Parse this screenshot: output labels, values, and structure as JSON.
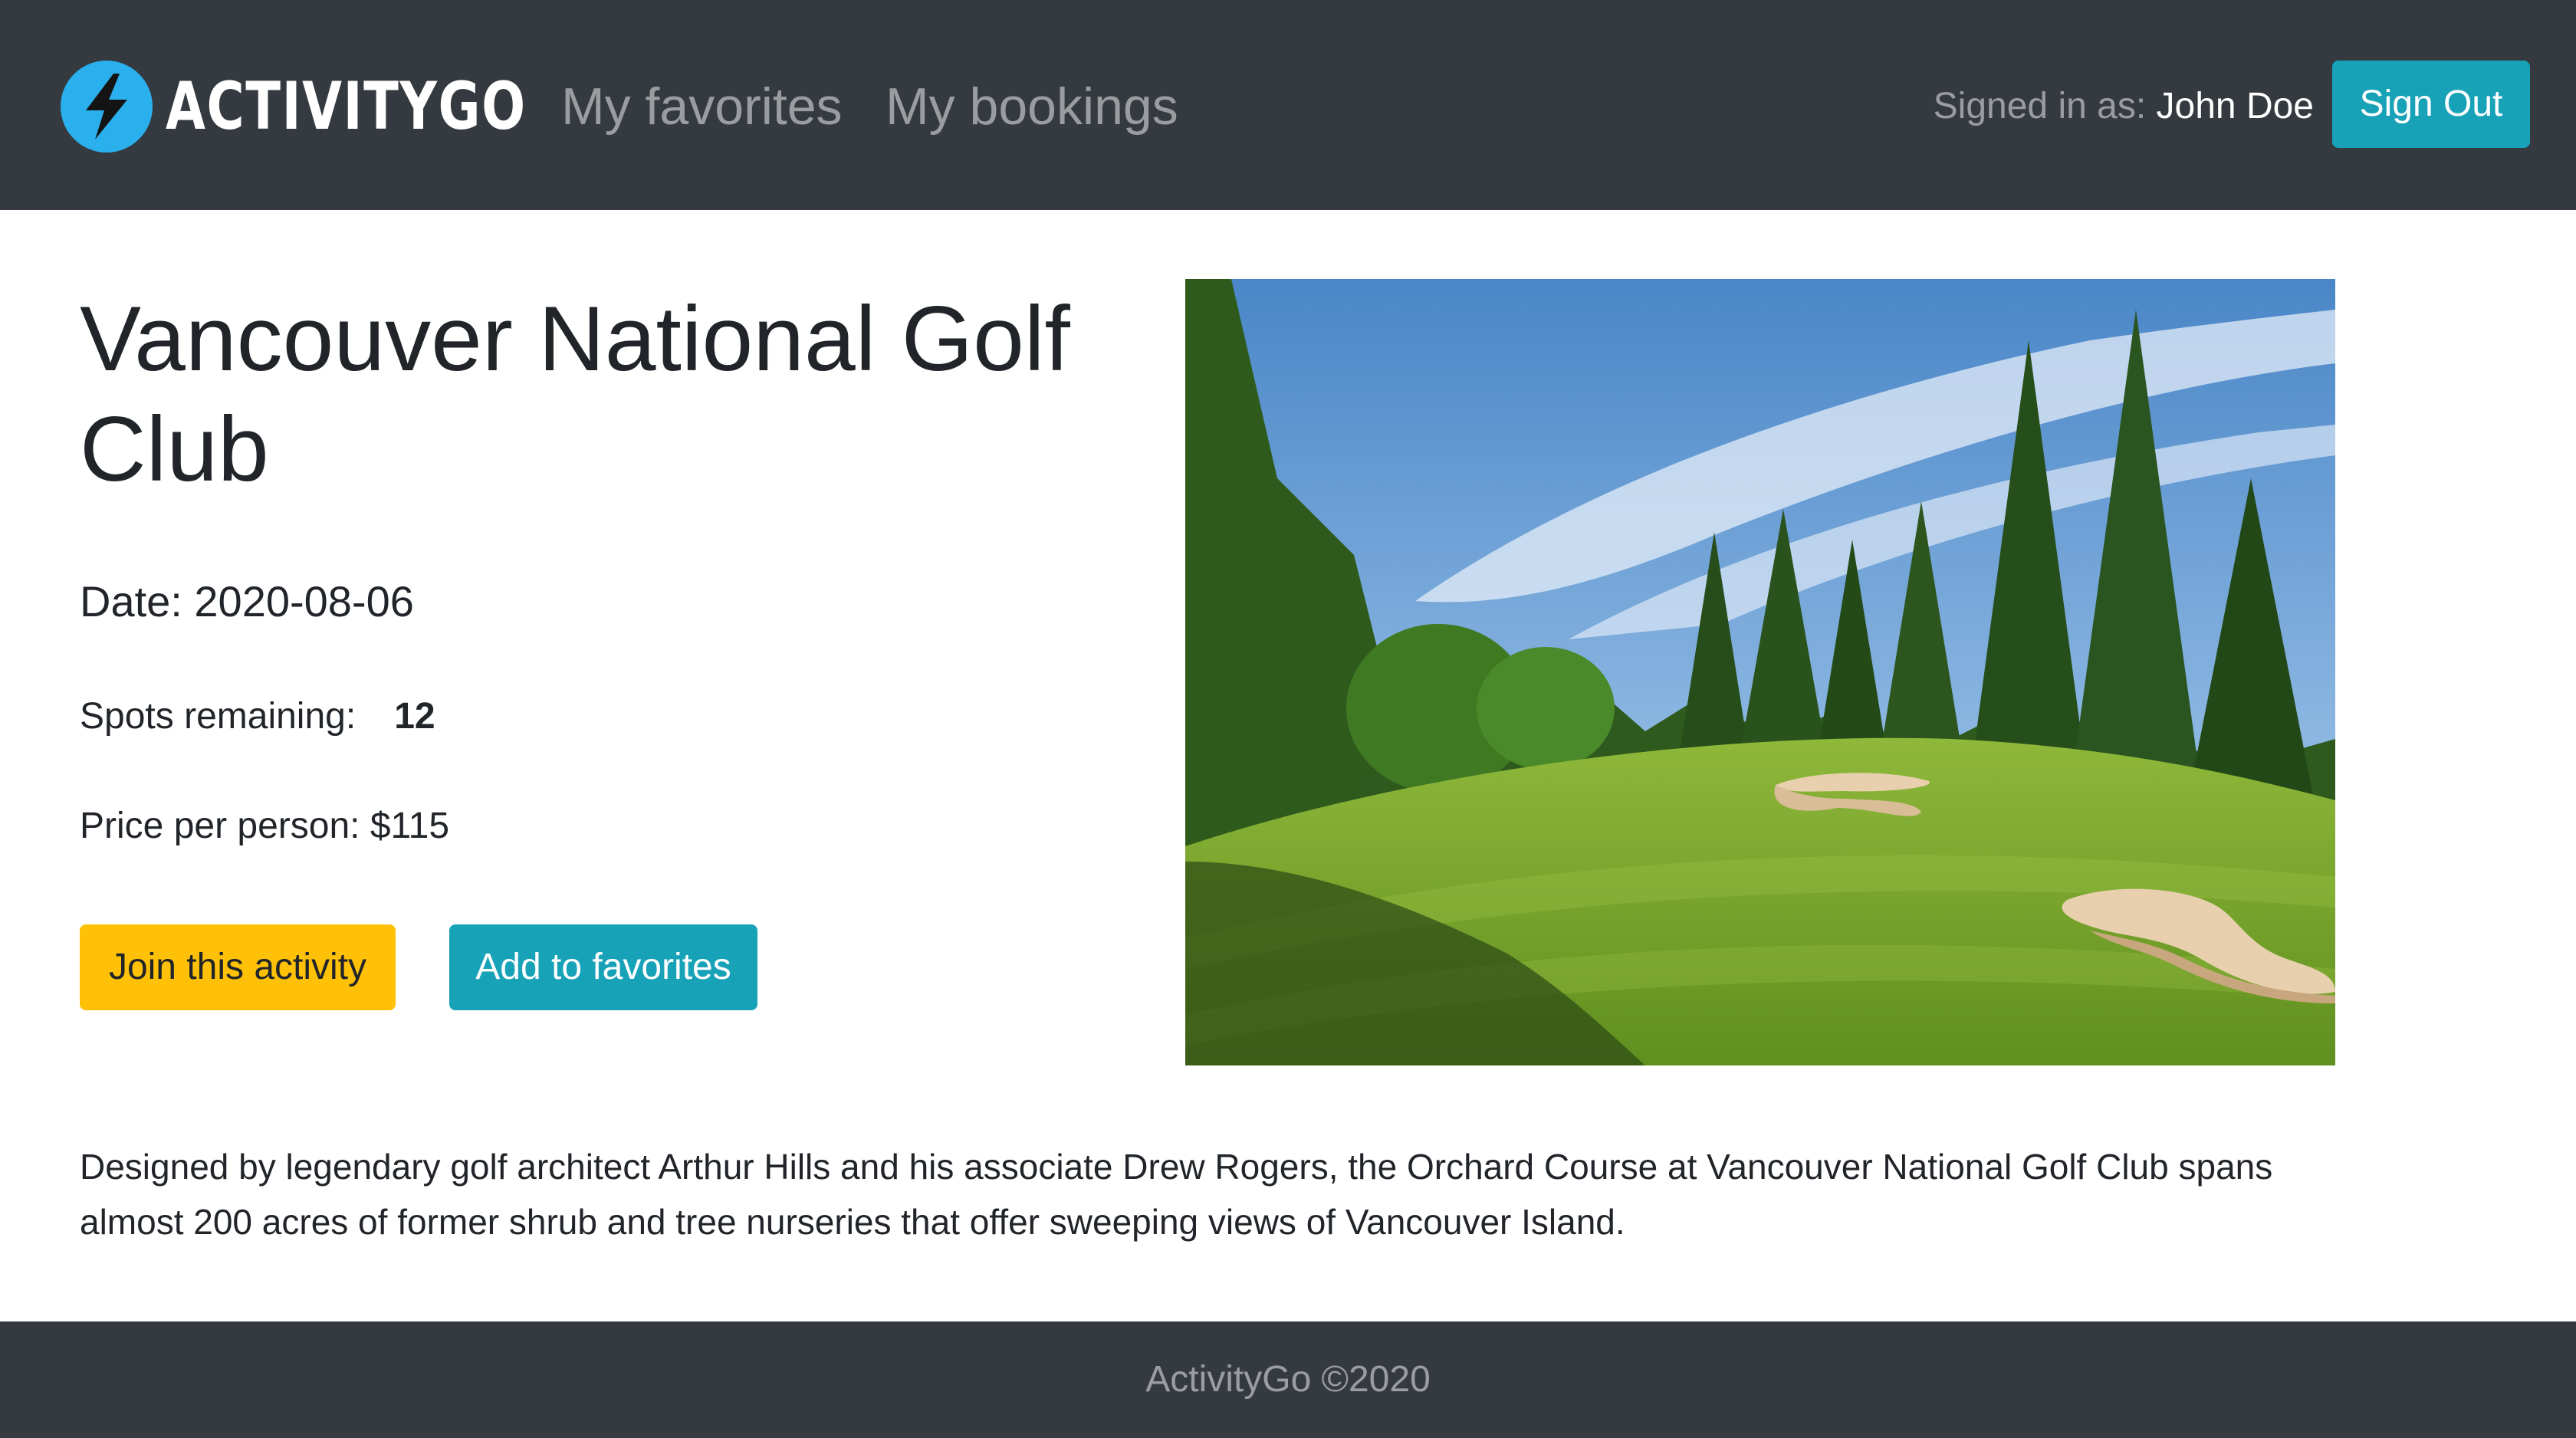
{
  "navbar": {
    "brand": "ACTIVITYGO",
    "brand_icon": "lightning-bolt-icon",
    "links": [
      {
        "label": "My favorites"
      },
      {
        "label": "My bookings"
      }
    ],
    "signed_in_label": "Signed in as:",
    "user_name": "John Doe",
    "sign_out_label": "Sign Out"
  },
  "activity": {
    "title": "Vancouver National Golf Club",
    "date_label": "Date: 2020-08-06",
    "spots_label": "Spots remaining:",
    "spots_value": "12",
    "price_label": "Price per person: $115",
    "join_label": "Join this activity",
    "favorite_label": "Add to favorites",
    "description": "Designed by legendary golf architect Arthur Hills and his associate Drew Rogers, the Orchard Course at Vancouver National Golf Club spans almost 200 acres of former shrub and tree nurseries that offer sweeping views of Vancouver Island."
  },
  "footer": {
    "text": "ActivityGo ©2020"
  },
  "colors": {
    "navbar_bg": "#343a40",
    "accent_info": "#17a2b8",
    "accent_warning": "#ffc107",
    "brand_icon_bg": "#2bb0ee"
  }
}
